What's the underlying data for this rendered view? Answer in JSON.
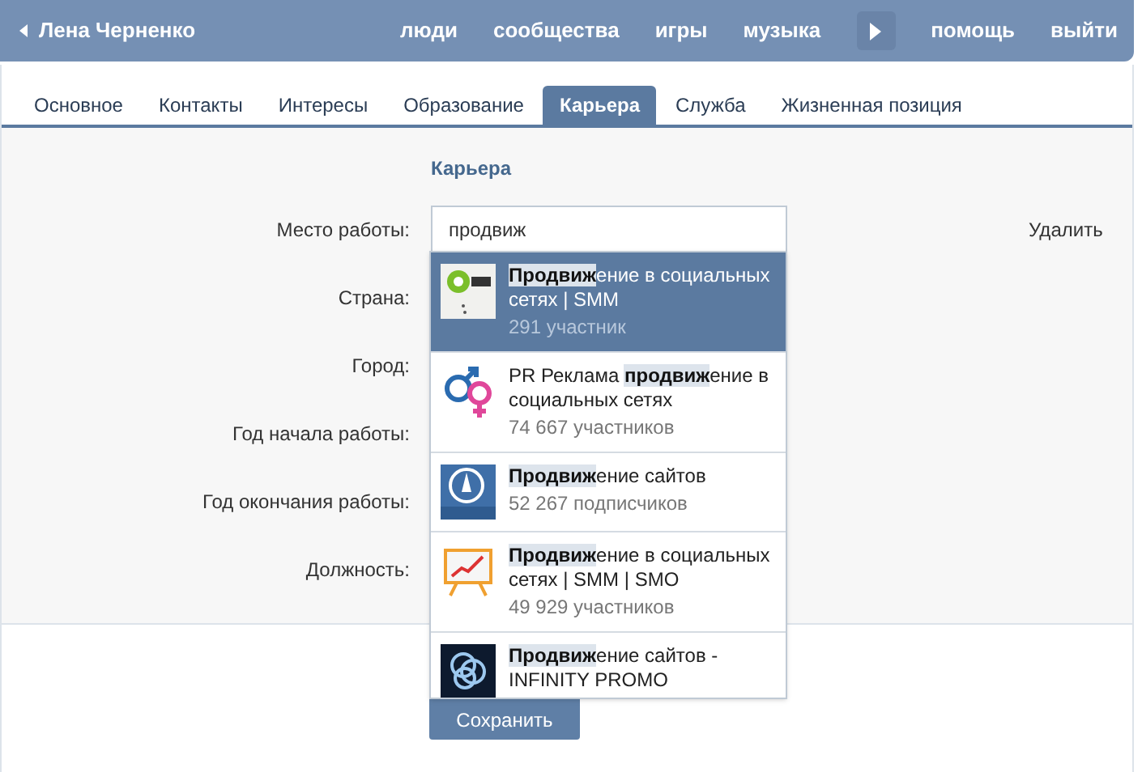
{
  "top_bar": {
    "user_name": "Лена Черненко",
    "nav": [
      {
        "kind": "link",
        "label": "люди"
      },
      {
        "kind": "link",
        "label": "сообщества"
      },
      {
        "kind": "link",
        "label": "игры"
      },
      {
        "kind": "link",
        "label": "музыка"
      },
      {
        "kind": "arrow"
      },
      {
        "kind": "link",
        "label": "помощь"
      },
      {
        "kind": "link",
        "label": "выйти"
      }
    ]
  },
  "tabs": [
    {
      "label": "Основное",
      "selected": false
    },
    {
      "label": "Контакты",
      "selected": false
    },
    {
      "label": "Интересы",
      "selected": false
    },
    {
      "label": "Образование",
      "selected": false
    },
    {
      "label": "Карьера",
      "selected": true
    },
    {
      "label": "Служба",
      "selected": false
    },
    {
      "label": "Жизненная позиция",
      "selected": false
    }
  ],
  "section_title": "Карьера",
  "fields": [
    {
      "label": "Место работы:"
    },
    {
      "label": "Страна:"
    },
    {
      "label": "Город:"
    },
    {
      "label": "Год начала работы:"
    },
    {
      "label": "Год окончания работы:"
    },
    {
      "label": "Должность:"
    }
  ],
  "workplace_value": "продвиж",
  "delete_link": "Удалить",
  "suggestions": [
    {
      "kind": "kiwi",
      "title": "**Продвиж**ение в социальных сетях | SMM",
      "count": "291 участник",
      "selected": true
    },
    {
      "kind": "vs",
      "title": "PR Реклама **продвиж**ение в социальных сетях",
      "count": "74 667 участников",
      "selected": false
    },
    {
      "kind": "rocket",
      "title": "**Продвиж**ение сайтов",
      "count": "52 267 подписчиков",
      "selected": false
    },
    {
      "kind": "chart",
      "title": "**Продвиж**ение в социальных сетях | SMM | SMO",
      "count": "49 929 участников",
      "selected": false
    },
    {
      "kind": "knot",
      "title": "**Продвиж**ение сайтов - INFINITY PROMO",
      "selected": false
    }
  ],
  "save_button": "Сохранить"
}
